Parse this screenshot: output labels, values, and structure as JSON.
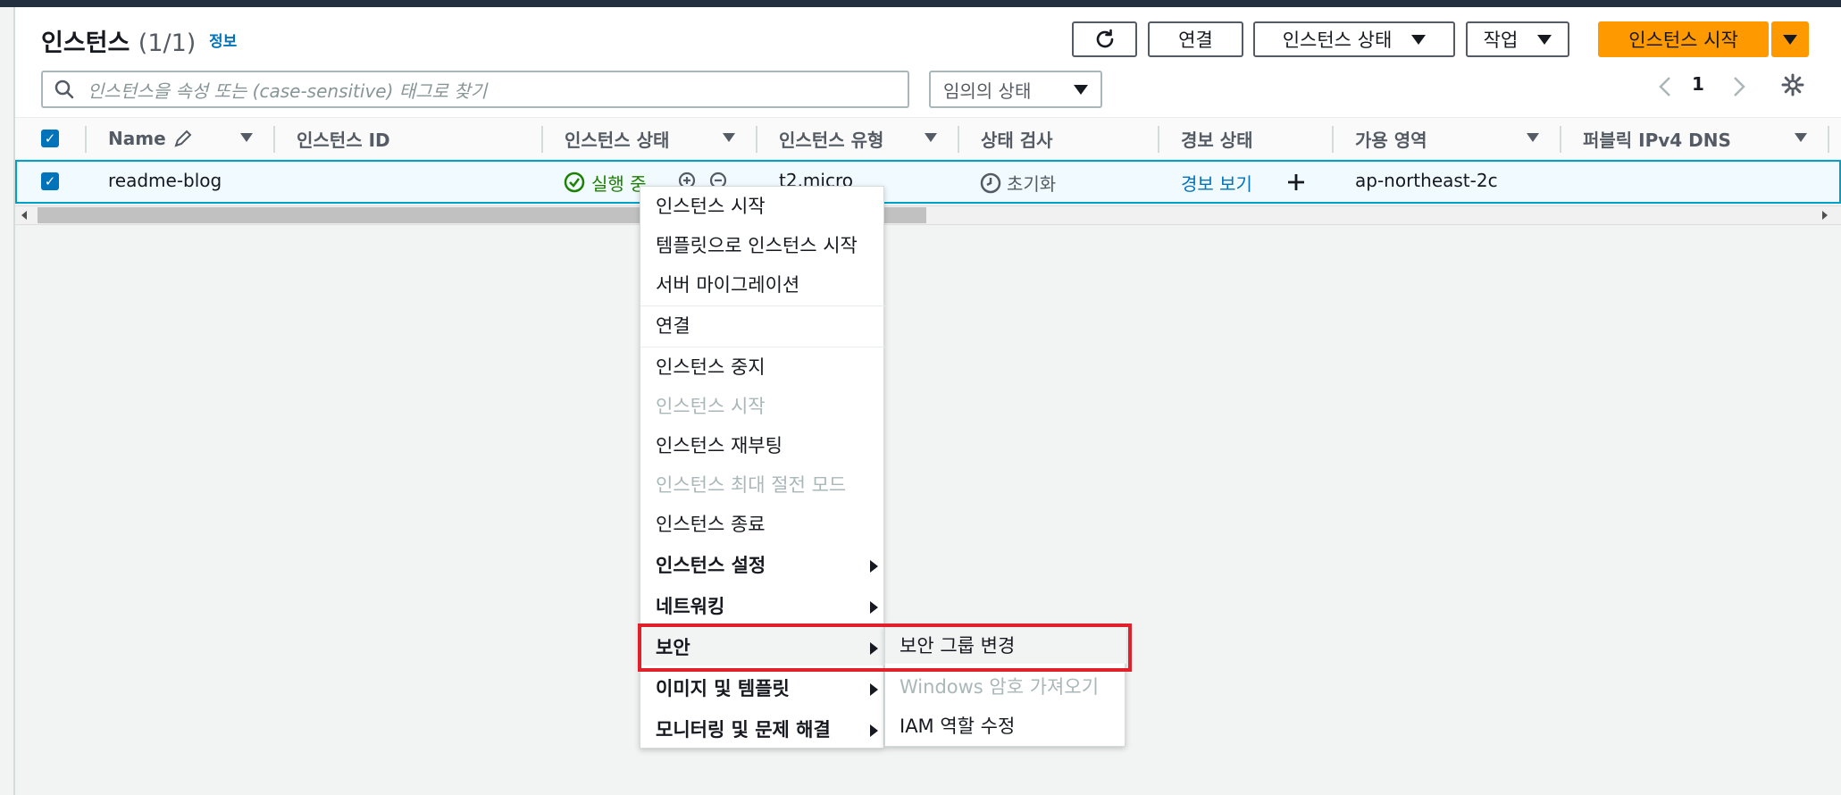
{
  "header": {
    "title": "인스턴스",
    "count": "(1/1)",
    "info_link": "정보"
  },
  "toolbar": {
    "refresh_label": "",
    "connect_label": "연결",
    "instance_state_label": "인스턴스 상태",
    "actions_label": "작업",
    "launch_label": "인스턴스 시작"
  },
  "search": {
    "placeholder": "인스턴스을 속성 또는 (case-sensitive) 태그로 찾기"
  },
  "filter_select": {
    "value": "임의의 상태"
  },
  "pagination": {
    "page": "1"
  },
  "table": {
    "columns": [
      "Name",
      "인스턴스 ID",
      "인스턴스 상태",
      "인스턴스 유형",
      "상태 검사",
      "경보 상태",
      "가용 영역",
      "퍼블릭 IPv4 DNS"
    ],
    "row": {
      "name": "readme-blog",
      "state": "실행 중",
      "type": "t2.micro",
      "status_check": "초기화",
      "alarm": "경보 보기",
      "az": "ap-northeast-2c"
    }
  },
  "context_menu": {
    "items": [
      "인스턴스 시작",
      "템플릿으로 인스턴스 시작",
      "서버 마이그레이션",
      "연결",
      "인스턴스 중지",
      "인스턴스 시작",
      "인스턴스 재부팅",
      "인스턴스 최대 절전 모드",
      "인스턴스 종료",
      "인스턴스 설정",
      "네트워킹",
      "보안",
      "이미지 및 템플릿",
      "모니터링 및 문제 해결"
    ]
  },
  "submenu": {
    "items": [
      "보안 그룹 변경",
      "Windows 암호 가져오기",
      "IAM 역할 수정"
    ]
  },
  "colors": {
    "accent": "#ff9900",
    "link": "#0073bb",
    "running": "#1d8102",
    "highlight": "#e0202a"
  }
}
